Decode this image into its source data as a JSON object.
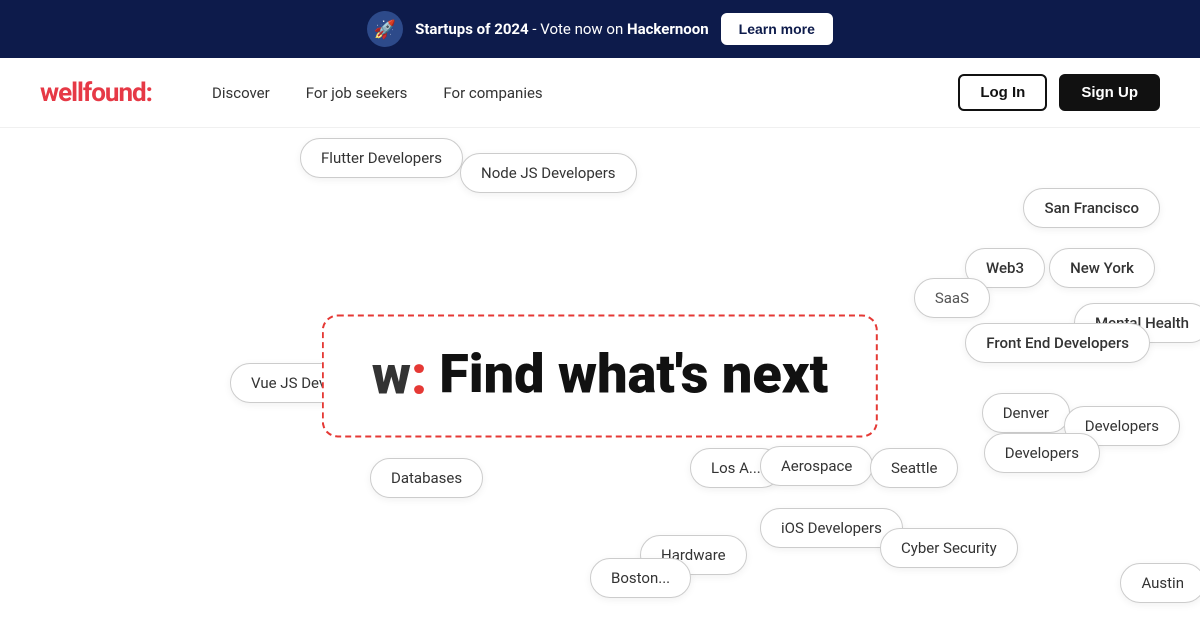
{
  "banner": {
    "text_startups": "Startups of 2024",
    "text_middle": " - Vote now on ",
    "text_hackernoon": "Hackernoon",
    "learn_more": "Learn more",
    "icon_alt": "rocket-icon"
  },
  "header": {
    "logo_text": "wellfound",
    "logo_colon": ":",
    "nav": {
      "discover": "Discover",
      "for_job_seekers": "For job seekers",
      "for_companies": "For companies"
    },
    "actions": {
      "login": "Log In",
      "signup": "Sign Up"
    }
  },
  "hero": {
    "w_letter": "w",
    "colon": ":",
    "headline": "Find what's next"
  },
  "tags": [
    {
      "id": "flutter",
      "label": "Flutter Developers",
      "class": "tag-flutter"
    },
    {
      "id": "nodejs",
      "label": "Node JS Developers",
      "class": "tag-nodejs"
    },
    {
      "id": "san-francisco",
      "label": "San Francisco",
      "class": "tag-san-francisco"
    },
    {
      "id": "web3",
      "label": "Web3",
      "class": "tag-web3"
    },
    {
      "id": "saas",
      "label": "SaaS",
      "class": "tag-saas"
    },
    {
      "id": "new-york",
      "label": "New York",
      "class": "tag-new-york"
    },
    {
      "id": "mental-health",
      "label": "Mental Health",
      "class": "tag-mental-health"
    },
    {
      "id": "front-end",
      "label": "Front End Developers",
      "class": "tag-front-end"
    },
    {
      "id": "vue",
      "label": "Vue JS Developers",
      "class": "tag-vue"
    },
    {
      "id": "denver",
      "label": "Denver",
      "class": "tag-denver"
    },
    {
      "id": "developers-1",
      "label": "Developers",
      "class": "tag-developers-1"
    },
    {
      "id": "developers-2",
      "label": "Developers",
      "class": "tag-developers-2"
    },
    {
      "id": "los-angeles",
      "label": "Los A...",
      "class": "tag-los-angeles"
    },
    {
      "id": "aerospace",
      "label": "Aerospace",
      "class": "tag-aerospace"
    },
    {
      "id": "seattle",
      "label": "Seattle",
      "class": "tag-seattle"
    },
    {
      "id": "databases",
      "label": "Databases",
      "class": "tag-databases"
    },
    {
      "id": "ios",
      "label": "iOS Developers",
      "class": "tag-ios"
    },
    {
      "id": "cyber",
      "label": "Cyber Security",
      "class": "tag-cyber"
    },
    {
      "id": "hardware",
      "label": "Hardware",
      "class": "tag-hardware"
    },
    {
      "id": "boston",
      "label": "Boston...",
      "class": "tag-boston"
    },
    {
      "id": "austin",
      "label": "Austin",
      "class": "tag-austin"
    }
  ]
}
